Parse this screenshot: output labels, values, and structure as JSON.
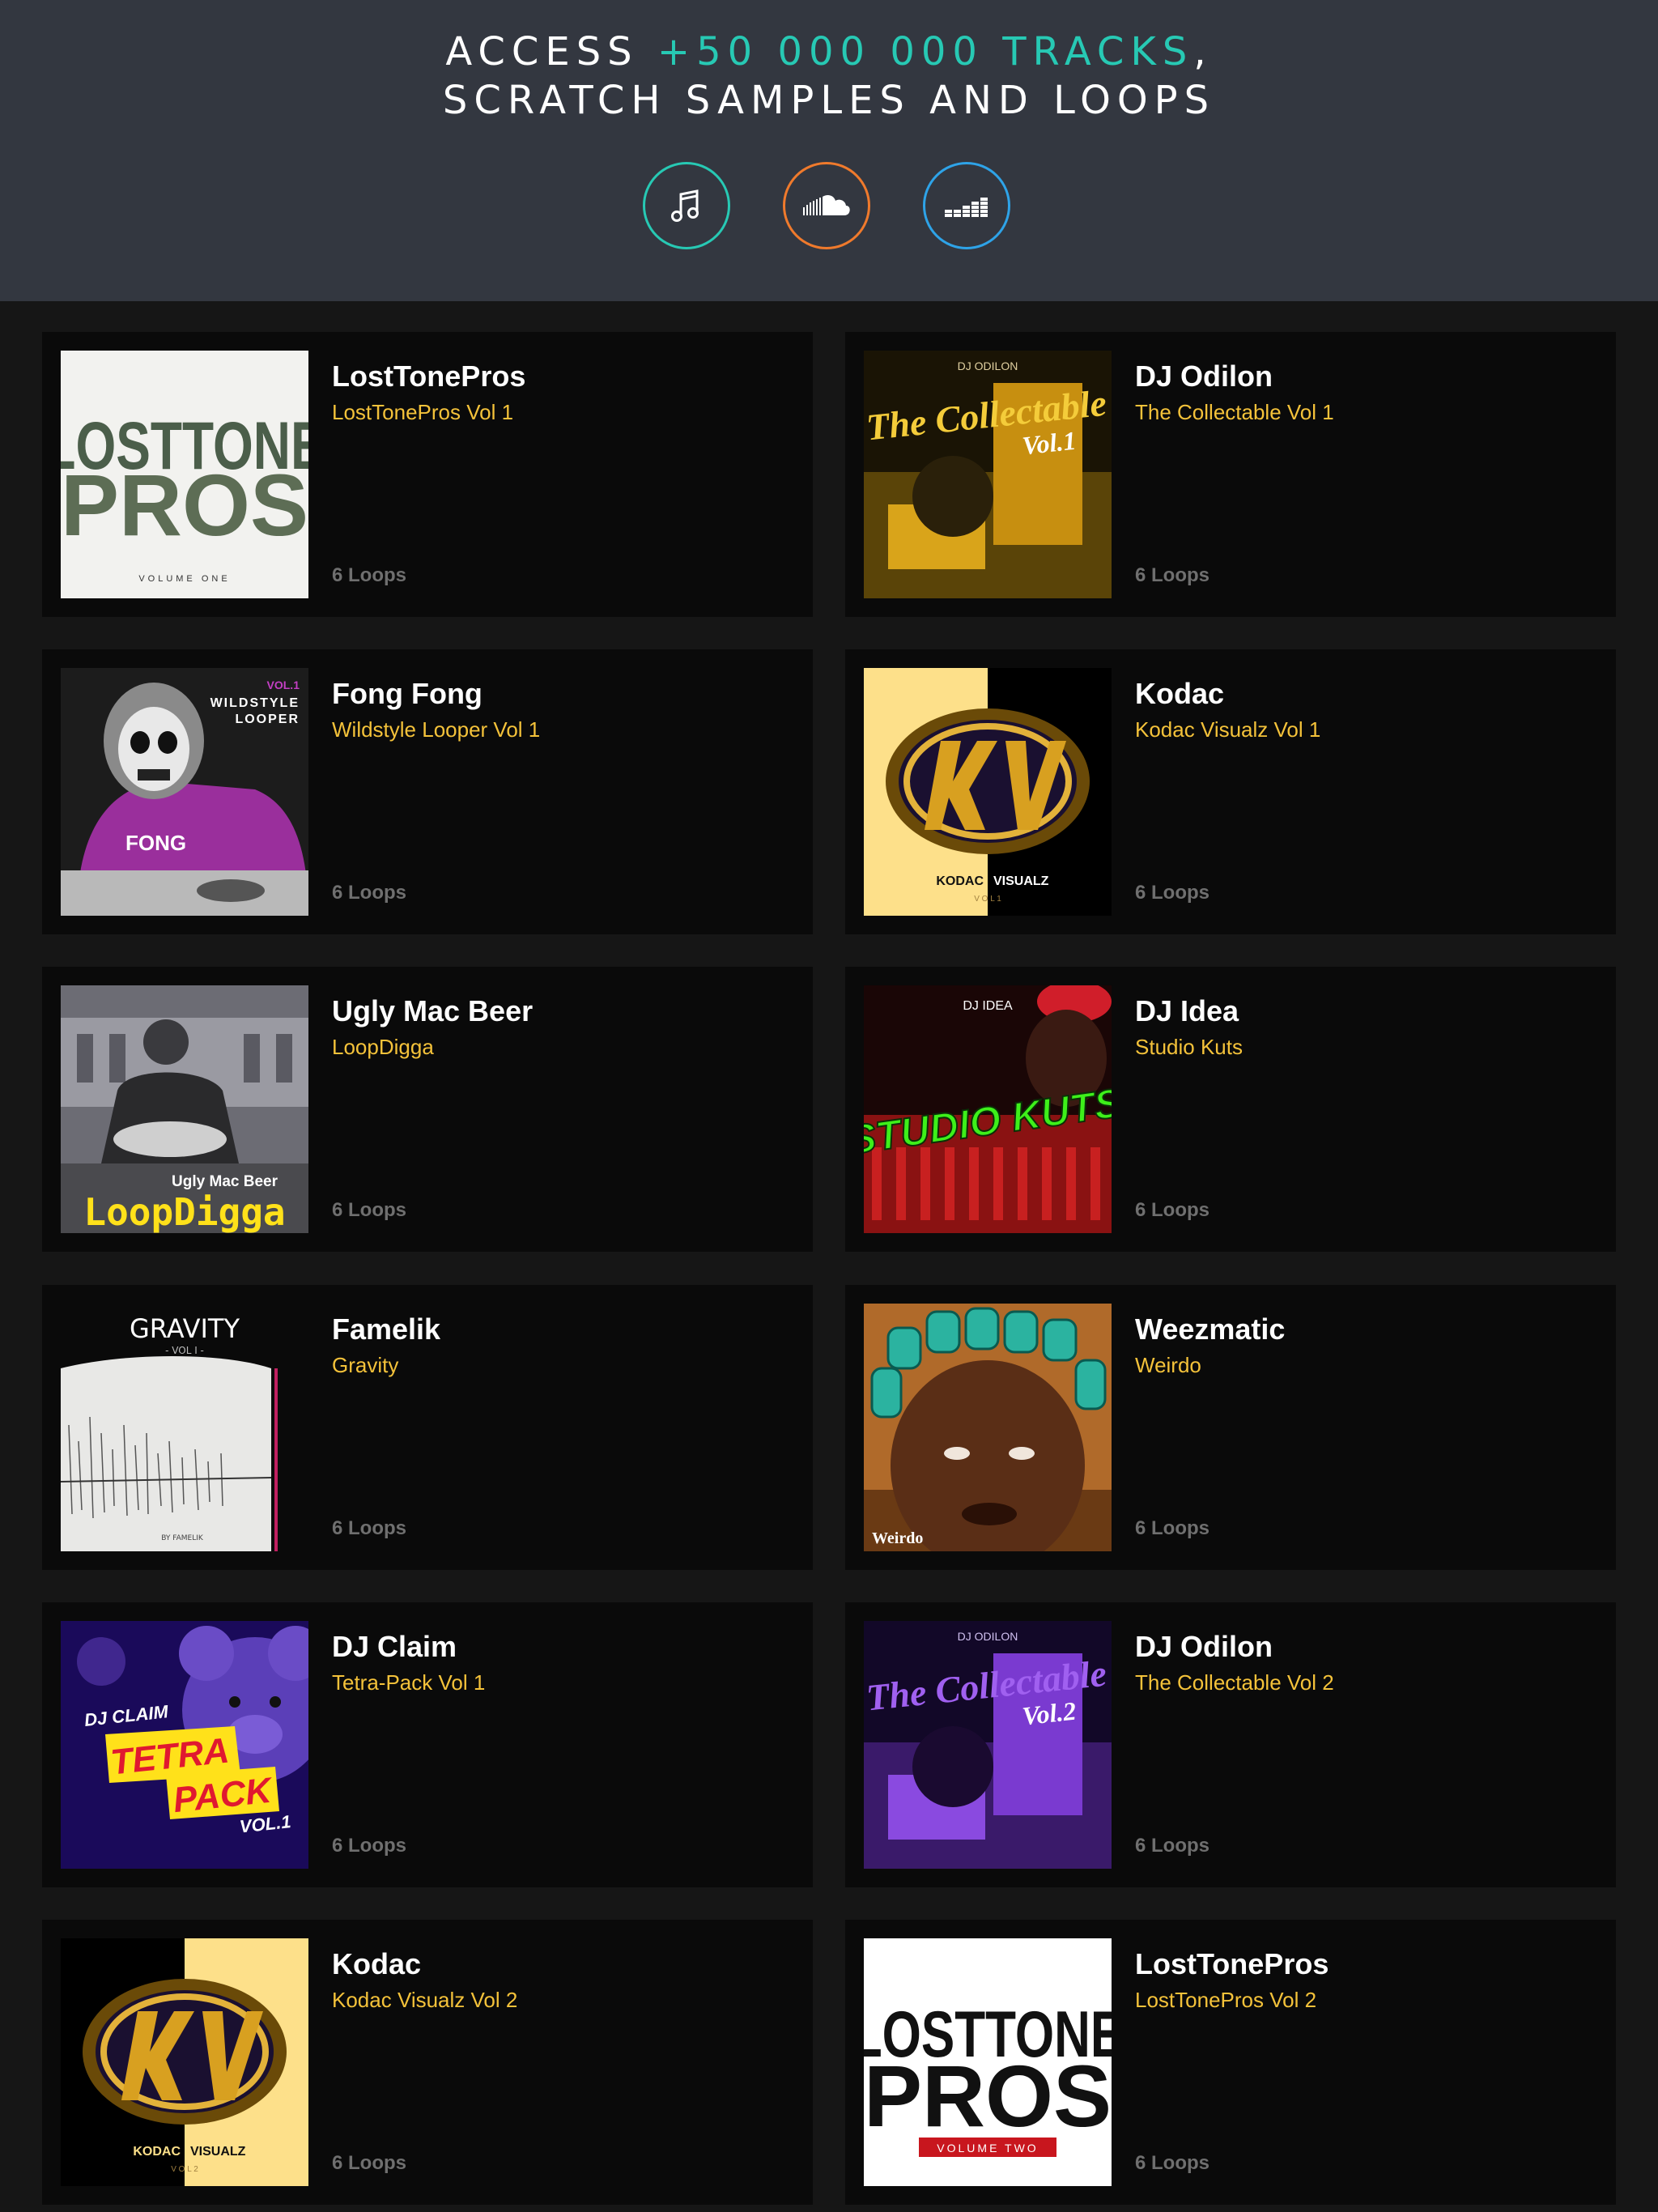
{
  "header": {
    "headline_prefix": "ACCESS ",
    "headline_accent": "+50 000 000 TRACKS",
    "headline_suffix": ",",
    "headline_line2": "SCRATCH SAMPLES AND LOOPS",
    "accent_color": "#27c9b4",
    "services": [
      {
        "name": "music-note-icon",
        "color": "#27c9b4"
      },
      {
        "name": "soundcloud-icon",
        "color": "#f07a2c"
      },
      {
        "name": "deezer-icon",
        "color": "#2ea3e8"
      }
    ]
  },
  "packs": [
    {
      "artist": "LostTonePros",
      "title": "LostTonePros Vol 1",
      "loops": "6 Loops",
      "cover_text": [
        "LOSTTONE",
        "PROS",
        "VOLUME ONE"
      ]
    },
    {
      "artist": "DJ Odilon",
      "title": "The Collectable Vol 1",
      "loops": "6 Loops",
      "cover_text": [
        "DJ ODILON",
        "The Collectable",
        "Vol.1"
      ]
    },
    {
      "artist": "Fong Fong",
      "title": "Wildstyle Looper Vol 1",
      "loops": "6 Loops",
      "cover_text": [
        "VOL.1",
        "WILDSTYLE",
        "LOOPER",
        "FONG"
      ]
    },
    {
      "artist": "Kodac",
      "title": "Kodac Visualz Vol 1",
      "loops": "6 Loops",
      "cover_text": [
        "KODAC",
        "VISUALZ",
        "V O L  1"
      ]
    },
    {
      "artist": "Ugly Mac Beer",
      "title": "LoopDigga",
      "loops": "6 Loops",
      "cover_text": [
        "Ugly Mac Beer",
        "LoopDigga"
      ]
    },
    {
      "artist": "DJ Idea",
      "title": "Studio Kuts",
      "loops": "6 Loops",
      "cover_text": [
        "DJ IDEA",
        "STUDIO KUTS"
      ]
    },
    {
      "artist": "Famelik",
      "title": "Gravity",
      "loops": "6 Loops",
      "cover_text": [
        "GRAVITY",
        "- VOL I -",
        "BY FAMELIK"
      ]
    },
    {
      "artist": "Weezmatic",
      "title": "Weirdo",
      "loops": "6 Loops",
      "cover_text": [
        "Weirdo"
      ]
    },
    {
      "artist": "DJ Claim",
      "title": "Tetra-Pack Vol 1",
      "loops": "6 Loops",
      "cover_text": [
        "DJ CLAIM",
        "TETRA",
        "PACK",
        "VOL.1"
      ]
    },
    {
      "artist": "DJ Odilon",
      "title": "The Collectable Vol 2",
      "loops": "6 Loops",
      "cover_text": [
        "DJ ODILON",
        "The Collectable",
        "Vol.2"
      ]
    },
    {
      "artist": "Kodac",
      "title": "Kodac Visualz Vol 2",
      "loops": "6 Loops",
      "cover_text": [
        "KODAC",
        "VISUALZ",
        "V O L  2"
      ]
    },
    {
      "artist": "LostTonePros",
      "title": "LostTonePros Vol 2",
      "loops": "6 Loops",
      "cover_text": [
        "LOSTTONE",
        "PROS",
        "VOLUME TWO"
      ]
    }
  ]
}
